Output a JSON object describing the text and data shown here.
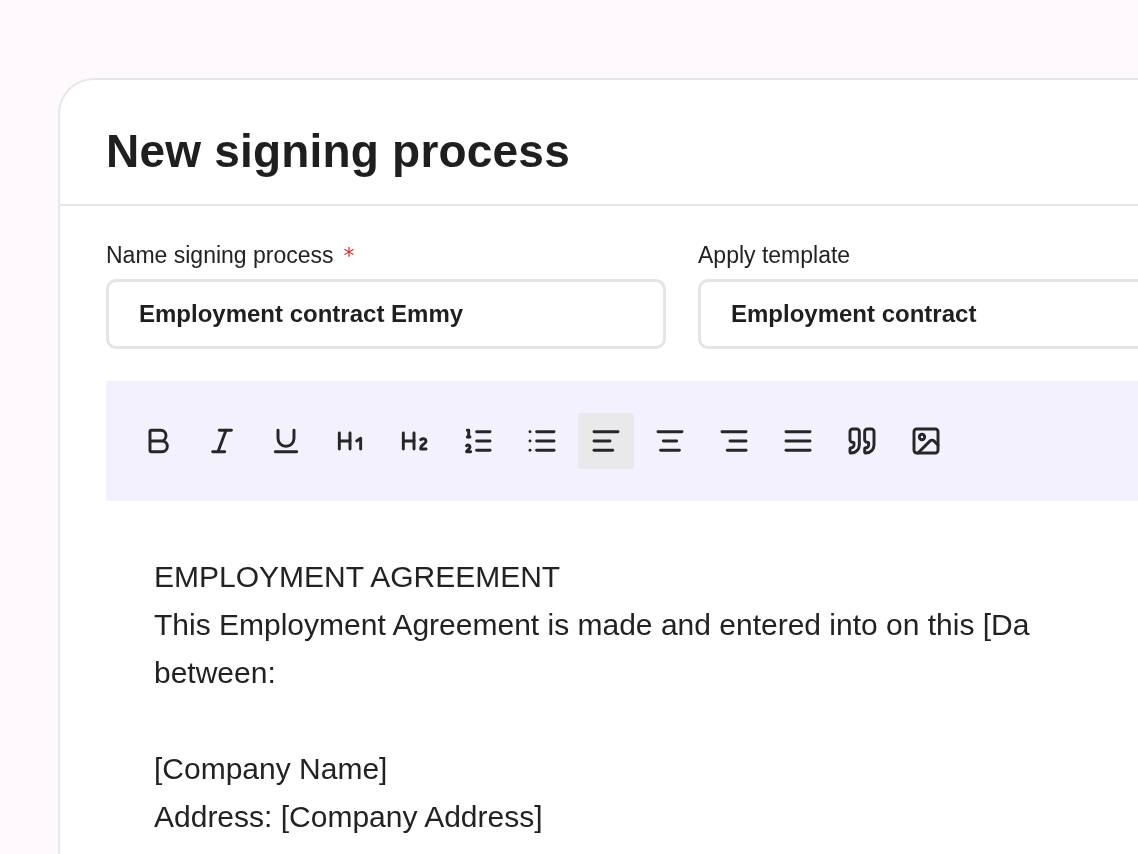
{
  "title": "New signing process",
  "fields": [
    {
      "label": "Name signing process",
      "required_mark": "*",
      "value": "Employment contract Emmy"
    },
    {
      "label": "Apply template",
      "value": "Employment contract"
    }
  ],
  "toolbar": [
    {
      "kind": "bold",
      "selected": false
    },
    {
      "kind": "italic",
      "selected": false
    },
    {
      "kind": "underline",
      "selected": false
    },
    {
      "kind": "heading1",
      "selected": false
    },
    {
      "kind": "heading2",
      "selected": false
    },
    {
      "kind": "ordered-list",
      "selected": false
    },
    {
      "kind": "bullet-list",
      "selected": false
    },
    {
      "kind": "align-left",
      "selected": true
    },
    {
      "kind": "align-center",
      "selected": false
    },
    {
      "kind": "align-right",
      "selected": false
    },
    {
      "kind": "justify",
      "selected": false
    },
    {
      "kind": "quote",
      "selected": false
    },
    {
      "kind": "image",
      "selected": false
    }
  ],
  "document": [
    [
      "EMPLOYMENT AGREEMENT",
      "This Employment Agreement is made and entered into on this [Da",
      "between:"
    ],
    [
      "[Company Name]",
      "Address: [Company Address]"
    ]
  ]
}
